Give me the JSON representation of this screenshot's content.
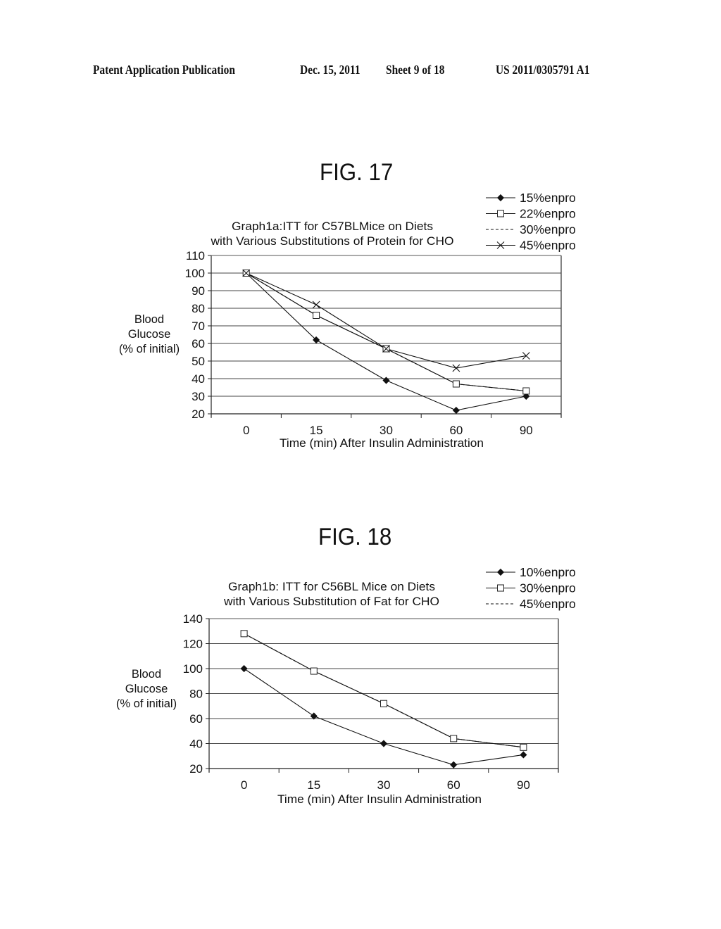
{
  "header": {
    "publication": "Patent Application Publication",
    "date": "Dec. 15, 2011",
    "sheet": "Sheet 9 of 18",
    "number": "US 2011/0305791 A1"
  },
  "chart_data": [
    {
      "figure_label": "FIG. 17",
      "type": "line",
      "title": [
        "Graph1a:ITT for C57BLMice on Diets",
        "with Various Substitutions of Protein for CHO"
      ],
      "xlabel": "Time (min) After Insulin Administration",
      "ylabel": [
        "Blood",
        "Glucose",
        "(% of initial)"
      ],
      "categories": [
        "0",
        "15",
        "30",
        "60",
        "90"
      ],
      "ylim": [
        20,
        110
      ],
      "yticks": [
        "110",
        "100",
        "90",
        "80",
        "70",
        "60",
        "50",
        "40",
        "30",
        "20"
      ],
      "ytick_values": [
        110,
        100,
        90,
        80,
        70,
        60,
        50,
        40,
        30,
        20
      ],
      "grid": true,
      "legend_position": "top-right",
      "series": [
        {
          "name": "15%enpro",
          "marker": "diamond",
          "line": "solid",
          "values": [
            100,
            62,
            39,
            22,
            30
          ]
        },
        {
          "name": "22%enpro",
          "marker": "square",
          "line": "solid",
          "values": [
            100,
            76,
            57,
            37,
            33
          ]
        },
        {
          "name": "30%enpro",
          "marker": "none",
          "line": "dashed",
          "values": [
            100,
            76,
            57,
            37,
            33
          ]
        },
        {
          "name": "45%enpro",
          "marker": "x",
          "line": "solid",
          "values": [
            100,
            82,
            57,
            46,
            53
          ]
        }
      ]
    },
    {
      "figure_label": "FIG. 18",
      "type": "line",
      "title": [
        "Graph1b: ITT for C56BL Mice on Diets",
        "with Various Substitution of Fat for CHO"
      ],
      "xlabel": "Time (min) After Insulin Administration",
      "ylabel": [
        "Blood",
        "Glucose",
        "(% of initial)"
      ],
      "categories": [
        "0",
        "15",
        "30",
        "60",
        "90"
      ],
      "ylim": [
        20,
        140
      ],
      "yticks": [
        "140",
        "120",
        "100",
        "80",
        "60",
        "40",
        "20"
      ],
      "ytick_values": [
        140,
        120,
        100,
        80,
        60,
        40,
        20
      ],
      "grid": true,
      "legend_position": "top-right",
      "series": [
        {
          "name": "10%enpro",
          "marker": "diamond",
          "line": "solid",
          "values": [
            100,
            62,
            40,
            23,
            31
          ]
        },
        {
          "name": "30%enpro",
          "marker": "square",
          "line": "solid",
          "values": [
            128,
            98,
            72,
            44,
            37
          ]
        },
        {
          "name": "45%enpro",
          "marker": "none",
          "line": "dashed",
          "values": [
            128,
            98,
            72,
            44,
            37
          ]
        }
      ]
    }
  ]
}
